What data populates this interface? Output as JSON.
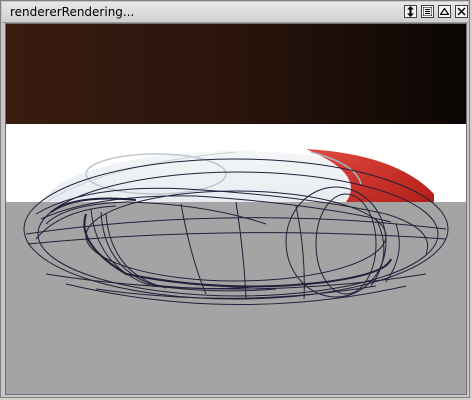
{
  "window": {
    "title": "rendererRendering...",
    "buttons": {
      "resize": "resize-arrows-icon",
      "menu": "menu-lines-icon",
      "up": "triangle-up-icon",
      "close": "close-icon"
    }
  },
  "viewport": {
    "background_top": "#2a140c",
    "background_mid": "#ffffff",
    "background_bottom": "#a4a4a4",
    "object_primary": "#e8eef4",
    "object_accent": "#d8322a",
    "wireframe": "#20203a"
  }
}
